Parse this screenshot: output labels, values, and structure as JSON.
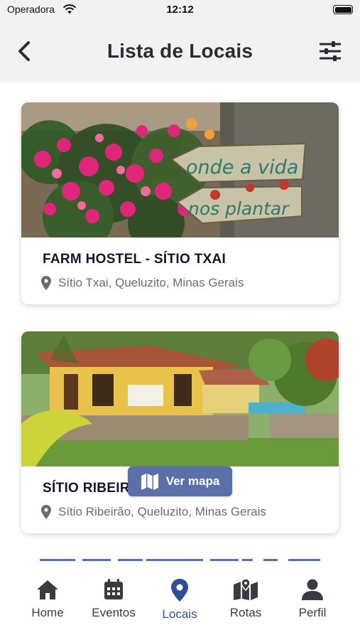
{
  "status": {
    "carrier": "Operadora",
    "time": "12:12"
  },
  "header": {
    "title": "Lista de Locais"
  },
  "places": [
    {
      "title": "FARM HOSTEL - SÍTIO TXAI",
      "location": "Sítio Txai, Queluzito, Minas Gerais",
      "sign_line1": "onde a vida",
      "sign_line2": "nos plantar"
    },
    {
      "title": "SÍTIO RIBEIRÃO",
      "title_visible": "SÍTIO RIBEIR",
      "location": "Sítio Ribeirão, Queluzito, Minas Gerais"
    }
  ],
  "map_button": {
    "label": "Ver mapa"
  },
  "tabs": [
    {
      "label": "Home",
      "icon": "home-icon"
    },
    {
      "label": "Eventos",
      "icon": "calendar-icon"
    },
    {
      "label": "Locais",
      "icon": "location-pin-icon",
      "active": true
    },
    {
      "label": "Rotas",
      "icon": "map-route-icon"
    },
    {
      "label": "Perfil",
      "icon": "user-icon"
    }
  ],
  "colors": {
    "accent": "#2c4f97",
    "map_button": "#5b70a8",
    "header_bg": "#f2f2f2"
  }
}
